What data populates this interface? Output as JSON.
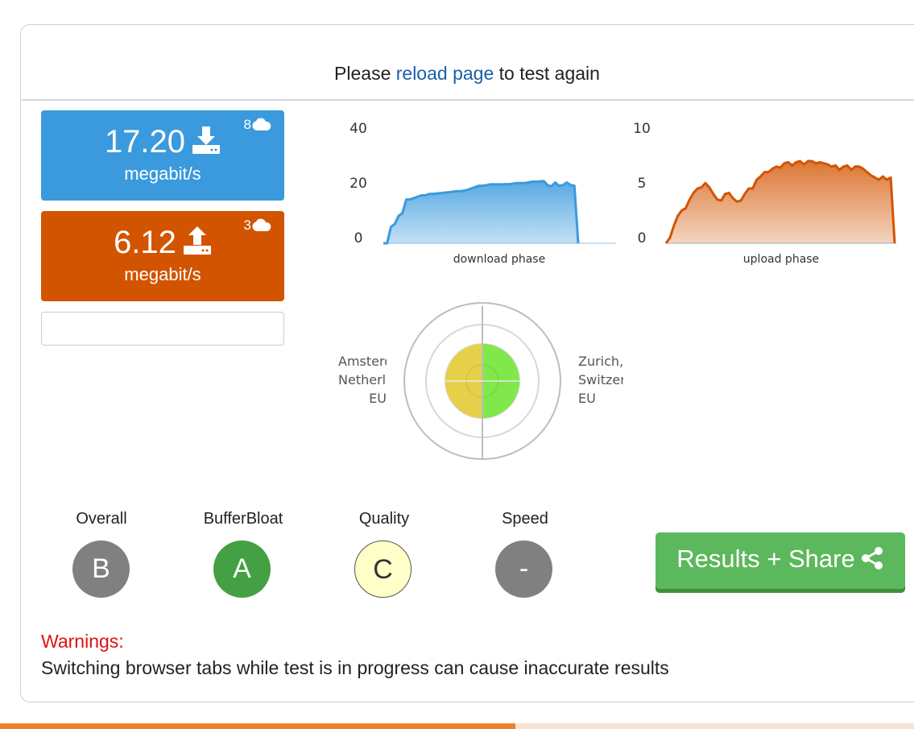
{
  "header": {
    "prefix": "Please",
    "link": "reload page",
    "suffix": "to test again"
  },
  "download": {
    "value": "17.20",
    "unit": "megabit/s",
    "streams": "8",
    "icon": "download-icon",
    "color": "#3a9add"
  },
  "upload": {
    "value": "6.12",
    "unit": "megabit/s",
    "streams": "3",
    "icon": "upload-icon",
    "color": "#d35400"
  },
  "chart_data": [
    {
      "type": "area",
      "xlabel": "download phase",
      "ylim": [
        0,
        40
      ],
      "yticks": [
        "40",
        "20",
        "0"
      ],
      "color": "#3a9add",
      "values": [
        0,
        0,
        6,
        7,
        10,
        11,
        16,
        16,
        16.5,
        17,
        17.5,
        17.5,
        18,
        18,
        18.2,
        18.3,
        18.5,
        18.6,
        18.8,
        19,
        19,
        19.2,
        19.5,
        20,
        20.5,
        21,
        21,
        21.2,
        21.5,
        21.5,
        21.5,
        21.5,
        21.6,
        21.6,
        21.8,
        22,
        22,
        22,
        22.2,
        22.5,
        22.5,
        22.6,
        22.7,
        21.2,
        20.8,
        22.2,
        21,
        21.2,
        22.2,
        21.3,
        21,
        0
      ]
    },
    {
      "type": "area",
      "xlabel": "upload phase",
      "ylim": [
        0,
        10
      ],
      "yticks": [
        "10",
        "5",
        "0"
      ],
      "color": "#d35400",
      "values": [
        0,
        0.5,
        1.6,
        2.5,
        3,
        3.2,
        4,
        4.6,
        5,
        5.1,
        5.5,
        5.1,
        4.5,
        4,
        3.9,
        4.5,
        4.6,
        4.1,
        3.8,
        3.9,
        4.5,
        5,
        5,
        5.8,
        6.1,
        6.5,
        6.5,
        6.8,
        7,
        6.9,
        7.3,
        7.4,
        7.1,
        7.4,
        7.5,
        7.2,
        7.5,
        7.5,
        7.3,
        7.4,
        7.3,
        7.2,
        7,
        7.1,
        6.7,
        7,
        7.1,
        6.7,
        7,
        7,
        6.8,
        6.5,
        6.2,
        6,
        5.8,
        6.1,
        5.8,
        6,
        0
      ]
    }
  ],
  "servers": {
    "left": [
      "Amsterdam,",
      "Netherlands,",
      "EU"
    ],
    "right": [
      "Zurich,",
      "Switzerland,",
      "EU"
    ]
  },
  "grades": [
    {
      "label": "Overall",
      "grade": "B",
      "bg": "#808080",
      "fg": "#ffffff"
    },
    {
      "label": "BufferBloat",
      "grade": "A",
      "bg": "#43a043",
      "fg": "#ffffff"
    },
    {
      "label": "Quality",
      "grade": "C",
      "bg": "#ffffc8",
      "fg": "#333333"
    },
    {
      "label": "Speed",
      "grade": "-",
      "bg": "#808080",
      "fg": "#ffffff"
    }
  ],
  "results_button": {
    "label": "Results + Share",
    "icon": "share-icon",
    "color": "#5cb85c"
  },
  "warnings": {
    "title": "Warnings:",
    "text": "Switching browser tabs while test is in progress can cause inaccurate results"
  }
}
